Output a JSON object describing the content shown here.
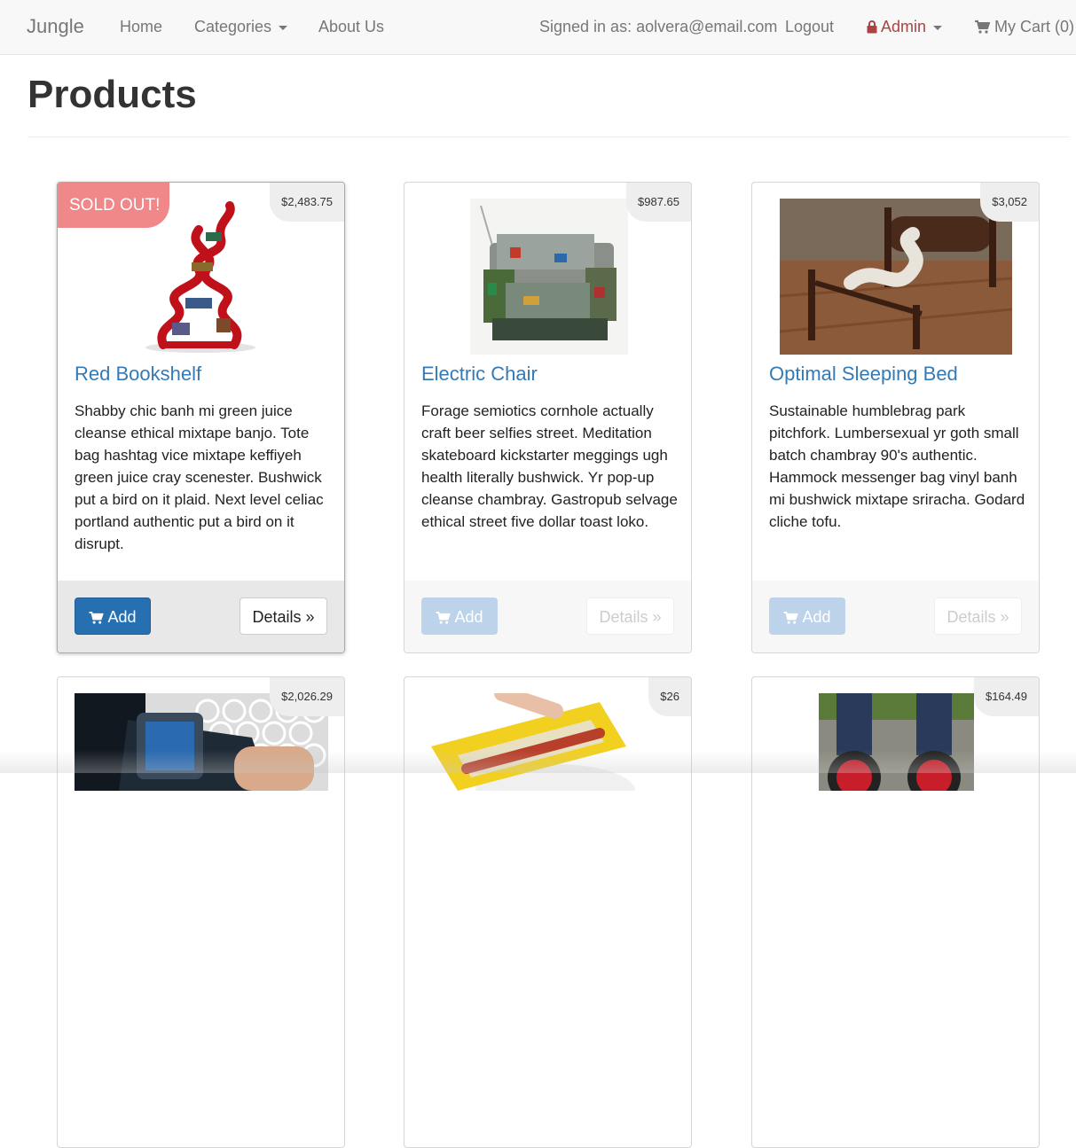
{
  "navbar": {
    "brand": "Jungle",
    "home": "Home",
    "categories": "Categories",
    "about": "About Us",
    "signed_in": "Signed in as: aolvera@email.com",
    "logout": "Logout",
    "admin": "Admin",
    "cart": "My Cart (0)"
  },
  "page": {
    "title": "Products"
  },
  "colors": {
    "link": "#337ab7",
    "admin": "#a94442",
    "add_button": "#2670b2",
    "sold_out": "#f0888a"
  },
  "products": [
    {
      "name": "Red Bookshelf",
      "price": "$2,483.75",
      "badge": "SOLD OUT!",
      "description": "Shabby chic banh mi green juice cleanse ethical mixtape banjo. Tote bag hashtag vice mixtape keffiyeh green juice cray scenester. Bushwick put a bird on it plaid. Next level celiac portland authentic put a bird on it disrupt.",
      "add_label": "Add",
      "details_label": "Details »"
    },
    {
      "name": "Electric Chair",
      "price": "$987.65",
      "description": "Forage semiotics cornhole actually craft beer selfies street. Meditation skateboard kickstarter meggings ugh health literally bushwick. Yr pop-up cleanse chambray. Gastropub selvage ethical street five dollar toast loko.",
      "add_label": "Add",
      "details_label": "Details »"
    },
    {
      "name": "Optimal Sleeping Bed",
      "price": "$3,052",
      "description": "Sustainable humblebrag park pitchfork. Lumbersexual yr goth small batch chambray 90's authentic. Hammock messenger bag vinyl banh mi bushwick mixtape sriracha. Godard cliche tofu.",
      "add_label": "Add",
      "details_label": "Details »"
    },
    {
      "price": "$2,026.29"
    },
    {
      "price": "$26"
    },
    {
      "price": "$164.49"
    }
  ]
}
